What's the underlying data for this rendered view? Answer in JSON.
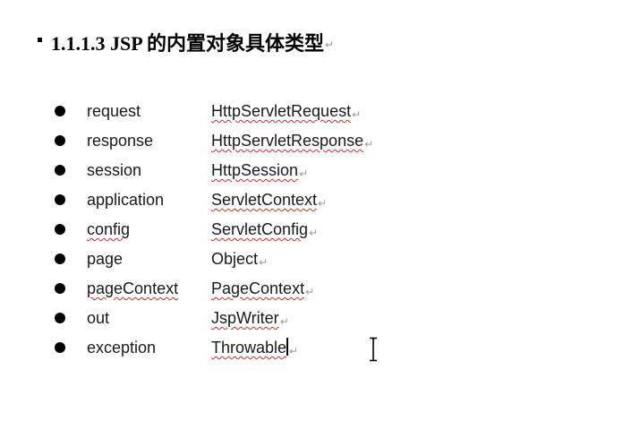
{
  "heading": {
    "text": "1.1.1.3 JSP 的内置对象具体类型"
  },
  "paragraph_mark": "↵",
  "objects": [
    {
      "name": "request",
      "type": "HttpServletRequest",
      "name_misspelled": false,
      "type_misspelled": true
    },
    {
      "name": "response",
      "type": "HttpServletResponse",
      "name_misspelled": false,
      "type_misspelled": true
    },
    {
      "name": "session",
      "type": "HttpSession",
      "name_misspelled": false,
      "type_misspelled": true
    },
    {
      "name": "application",
      "type": "ServletContext",
      "name_misspelled": false,
      "type_misspelled": true
    },
    {
      "name": "config",
      "type": "ServletConfig",
      "name_misspelled": true,
      "type_misspelled": true
    },
    {
      "name": "page",
      "type": "Object",
      "name_misspelled": false,
      "type_misspelled": false
    },
    {
      "name": "pageContext",
      "type": "PageContext",
      "name_misspelled": true,
      "type_misspelled": true
    },
    {
      "name": "out",
      "type": "JspWriter",
      "name_misspelled": false,
      "type_misspelled": true
    },
    {
      "name": "exception",
      "type": "Throwable",
      "name_misspelled": false,
      "type_misspelled": true
    }
  ],
  "colors": {
    "text": "#1a1a1a",
    "spellcheck_underline": "#d42a2a",
    "paragraph_mark": "#9a9a9a"
  },
  "cursor": {
    "caret_after_item": "exception",
    "pointer_icon": "text-ibeam-cursor-icon"
  }
}
